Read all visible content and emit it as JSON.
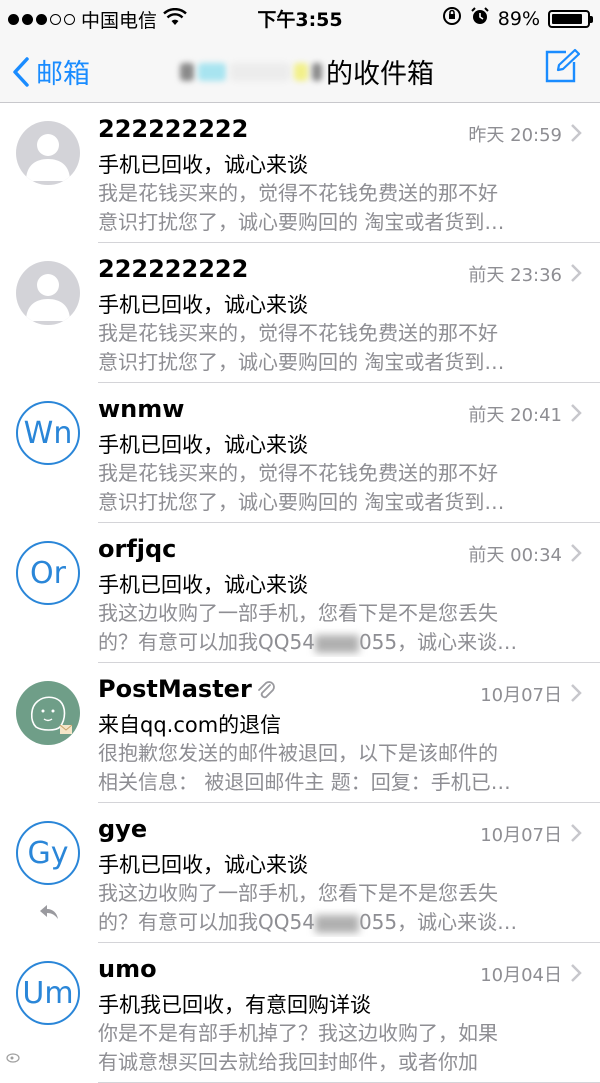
{
  "status_bar": {
    "carrier": "中国电信",
    "time": "下午3:55",
    "battery": "89%",
    "battery_level": 0.89
  },
  "nav": {
    "back_label": "邮箱",
    "title_suffix": "的收件箱"
  },
  "mails": [
    {
      "sender": "222222222",
      "date": "昨天 20:59",
      "subject": "手机已回收，诚心来谈",
      "preview_line1": "我是花钱买来的，觉得不花钱免费送的那不好",
      "preview_line2": "意识打扰您了，诚心要购回的 淘宝或者货到…",
      "avatar_type": "person"
    },
    {
      "sender": "222222222",
      "date": "前天 23:36",
      "subject": "手机已回收，诚心来谈",
      "preview_line1": "我是花钱买来的，觉得不花钱免费送的那不好",
      "preview_line2": "意识打扰您了，诚心要购回的 淘宝或者货到…",
      "avatar_type": "person"
    },
    {
      "sender": "wnmw",
      "date": "前天 20:41",
      "subject": "手机已回收，诚心来谈",
      "preview_line1": "我是花钱买来的，觉得不花钱免费送的那不好",
      "preview_line2": "意识打扰您了，诚心要购回的 淘宝或者货到…",
      "avatar_type": "initials",
      "initials": "Wn"
    },
    {
      "sender": "orfjqc",
      "date": "前天 00:34",
      "subject": "手机已回收，诚心来谈",
      "preview_line1": "我这边收购了一部手机，您看下是不是您丢失",
      "preview_line2a": "的？有意可以加我QQ54",
      "preview_line2b": "055，诚心来谈…",
      "avatar_type": "initials",
      "initials": "Or"
    },
    {
      "sender": "PostMaster",
      "date": "10月07日",
      "subject": "来自qq.com的退信",
      "preview_line1": "很抱歉您发送的邮件被退回，以下是该邮件的",
      "preview_line2": "相关信息： 被退回邮件主 题：回复：手机已…",
      "avatar_type": "postmaster",
      "has_attachment": true
    },
    {
      "sender": "gye",
      "date": "10月07日",
      "subject": "手机已回收，诚心来谈",
      "preview_line1": "我这边收购了一部手机，您看下是不是您丢失",
      "preview_line2a": "的？有意可以加我QQ54",
      "preview_line2b": "055，诚心来谈…",
      "avatar_type": "initials",
      "initials": "Gy",
      "replied": true
    },
    {
      "sender": "umo",
      "date": "10月04日",
      "subject": "手机我已回收，有意回购详谈",
      "preview_line1": "你是不是有部手机掉了？我这边收购了，如果",
      "preview_line2": "有诚意想买回去就给我回封邮件，或者你加",
      "avatar_type": "initials",
      "initials": "Um"
    }
  ],
  "colors": {
    "accent": "#1a8cff",
    "initials": "#2a86d8",
    "secondary_text": "#8e8e93"
  },
  "icons": [
    "signal-dots-icon",
    "wifi-icon",
    "orientation-lock-icon",
    "alarm-icon",
    "battery-icon",
    "back-chevron-icon",
    "compose-icon",
    "chevron-right-icon",
    "paperclip-icon",
    "reply-arrow-icon"
  ]
}
